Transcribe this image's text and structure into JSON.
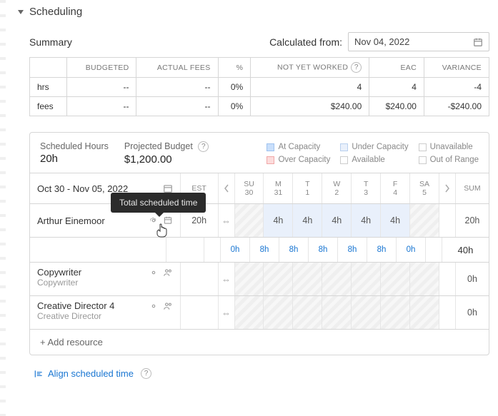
{
  "section": {
    "title": "Scheduling"
  },
  "summary": {
    "label": "Summary",
    "calc_label": "Calculated from:",
    "calc_value": "Nov 04, 2022",
    "headers": {
      "budgeted": "BUDGETED",
      "actual": "ACTUAL FEES",
      "pct": "%",
      "not_yet": "NOT YET WORKED",
      "eac": "EAC",
      "variance": "VARIANCE"
    },
    "rows": [
      {
        "label": "hrs",
        "budgeted": "--",
        "actual": "--",
        "pct": "0%",
        "not_yet": "4",
        "eac": "4",
        "variance": "-4"
      },
      {
        "label": "fees",
        "budgeted": "--",
        "actual": "--",
        "pct": "0%",
        "not_yet": "$240.00",
        "eac": "$240.00",
        "variance": "-$240.00"
      }
    ]
  },
  "sched": {
    "hours_lbl": "Scheduled Hours",
    "hours_val": "20h",
    "budget_lbl": "Projected Budget",
    "budget_val": "$1,200.00",
    "legend": {
      "at": "At Capacity",
      "under": "Under Capacity",
      "unavail": "Unavailable",
      "over": "Over Capacity",
      "avail": "Available",
      "out": "Out of Range"
    },
    "range": "Oct 30 - Nov 05, 2022",
    "est_head": "EST",
    "days": [
      {
        "d": "SU",
        "n": "30"
      },
      {
        "d": "M",
        "n": "31"
      },
      {
        "d": "T",
        "n": "1"
      },
      {
        "d": "W",
        "n": "2"
      },
      {
        "d": "T",
        "n": "3"
      },
      {
        "d": "F",
        "n": "4"
      },
      {
        "d": "SA",
        "n": "5"
      }
    ],
    "sum_head": "SUM",
    "rows": [
      {
        "name": "Arthur Einemoor",
        "est": "20h",
        "cells": [
          "",
          "4h",
          "4h",
          "4h",
          "4h",
          "4h",
          ""
        ],
        "sum": "20h",
        "hatch_first": true,
        "hatch_last": true,
        "blue": true
      }
    ],
    "link_row": {
      "cells": [
        "0h",
        "8h",
        "8h",
        "8h",
        "8h",
        "8h",
        "0h"
      ],
      "sum": "40h"
    },
    "role_rows": [
      {
        "name": "Copywriter",
        "role": "Copywriter",
        "sum": "0h"
      },
      {
        "name": "Creative Director 4",
        "role": "Creative Director",
        "sum": "0h"
      }
    ],
    "add": "+ Add resource"
  },
  "tooltip": "Total scheduled time",
  "align": "Align scheduled time"
}
